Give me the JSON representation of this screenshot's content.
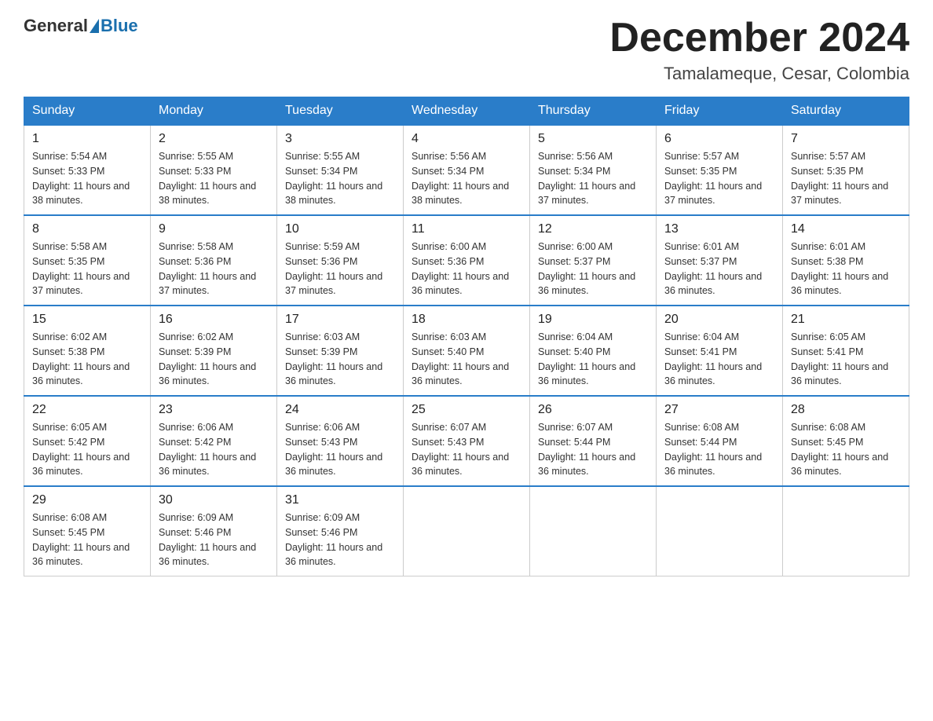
{
  "header": {
    "logo_general": "General",
    "logo_blue": "Blue",
    "month_title": "December 2024",
    "location": "Tamalameque, Cesar, Colombia"
  },
  "weekdays": [
    "Sunday",
    "Monday",
    "Tuesday",
    "Wednesday",
    "Thursday",
    "Friday",
    "Saturday"
  ],
  "weeks": [
    [
      {
        "day": "1",
        "sunrise": "5:54 AM",
        "sunset": "5:33 PM",
        "daylight": "11 hours and 38 minutes."
      },
      {
        "day": "2",
        "sunrise": "5:55 AM",
        "sunset": "5:33 PM",
        "daylight": "11 hours and 38 minutes."
      },
      {
        "day": "3",
        "sunrise": "5:55 AM",
        "sunset": "5:34 PM",
        "daylight": "11 hours and 38 minutes."
      },
      {
        "day": "4",
        "sunrise": "5:56 AM",
        "sunset": "5:34 PM",
        "daylight": "11 hours and 38 minutes."
      },
      {
        "day": "5",
        "sunrise": "5:56 AM",
        "sunset": "5:34 PM",
        "daylight": "11 hours and 37 minutes."
      },
      {
        "day": "6",
        "sunrise": "5:57 AM",
        "sunset": "5:35 PM",
        "daylight": "11 hours and 37 minutes."
      },
      {
        "day": "7",
        "sunrise": "5:57 AM",
        "sunset": "5:35 PM",
        "daylight": "11 hours and 37 minutes."
      }
    ],
    [
      {
        "day": "8",
        "sunrise": "5:58 AM",
        "sunset": "5:35 PM",
        "daylight": "11 hours and 37 minutes."
      },
      {
        "day": "9",
        "sunrise": "5:58 AM",
        "sunset": "5:36 PM",
        "daylight": "11 hours and 37 minutes."
      },
      {
        "day": "10",
        "sunrise": "5:59 AM",
        "sunset": "5:36 PM",
        "daylight": "11 hours and 37 minutes."
      },
      {
        "day": "11",
        "sunrise": "6:00 AM",
        "sunset": "5:36 PM",
        "daylight": "11 hours and 36 minutes."
      },
      {
        "day": "12",
        "sunrise": "6:00 AM",
        "sunset": "5:37 PM",
        "daylight": "11 hours and 36 minutes."
      },
      {
        "day": "13",
        "sunrise": "6:01 AM",
        "sunset": "5:37 PM",
        "daylight": "11 hours and 36 minutes."
      },
      {
        "day": "14",
        "sunrise": "6:01 AM",
        "sunset": "5:38 PM",
        "daylight": "11 hours and 36 minutes."
      }
    ],
    [
      {
        "day": "15",
        "sunrise": "6:02 AM",
        "sunset": "5:38 PM",
        "daylight": "11 hours and 36 minutes."
      },
      {
        "day": "16",
        "sunrise": "6:02 AM",
        "sunset": "5:39 PM",
        "daylight": "11 hours and 36 minutes."
      },
      {
        "day": "17",
        "sunrise": "6:03 AM",
        "sunset": "5:39 PM",
        "daylight": "11 hours and 36 minutes."
      },
      {
        "day": "18",
        "sunrise": "6:03 AM",
        "sunset": "5:40 PM",
        "daylight": "11 hours and 36 minutes."
      },
      {
        "day": "19",
        "sunrise": "6:04 AM",
        "sunset": "5:40 PM",
        "daylight": "11 hours and 36 minutes."
      },
      {
        "day": "20",
        "sunrise": "6:04 AM",
        "sunset": "5:41 PM",
        "daylight": "11 hours and 36 minutes."
      },
      {
        "day": "21",
        "sunrise": "6:05 AM",
        "sunset": "5:41 PM",
        "daylight": "11 hours and 36 minutes."
      }
    ],
    [
      {
        "day": "22",
        "sunrise": "6:05 AM",
        "sunset": "5:42 PM",
        "daylight": "11 hours and 36 minutes."
      },
      {
        "day": "23",
        "sunrise": "6:06 AM",
        "sunset": "5:42 PM",
        "daylight": "11 hours and 36 minutes."
      },
      {
        "day": "24",
        "sunrise": "6:06 AM",
        "sunset": "5:43 PM",
        "daylight": "11 hours and 36 minutes."
      },
      {
        "day": "25",
        "sunrise": "6:07 AM",
        "sunset": "5:43 PM",
        "daylight": "11 hours and 36 minutes."
      },
      {
        "day": "26",
        "sunrise": "6:07 AM",
        "sunset": "5:44 PM",
        "daylight": "11 hours and 36 minutes."
      },
      {
        "day": "27",
        "sunrise": "6:08 AM",
        "sunset": "5:44 PM",
        "daylight": "11 hours and 36 minutes."
      },
      {
        "day": "28",
        "sunrise": "6:08 AM",
        "sunset": "5:45 PM",
        "daylight": "11 hours and 36 minutes."
      }
    ],
    [
      {
        "day": "29",
        "sunrise": "6:08 AM",
        "sunset": "5:45 PM",
        "daylight": "11 hours and 36 minutes."
      },
      {
        "day": "30",
        "sunrise": "6:09 AM",
        "sunset": "5:46 PM",
        "daylight": "11 hours and 36 minutes."
      },
      {
        "day": "31",
        "sunrise": "6:09 AM",
        "sunset": "5:46 PM",
        "daylight": "11 hours and 36 minutes."
      },
      null,
      null,
      null,
      null
    ]
  ],
  "labels": {
    "sunrise": "Sunrise:",
    "sunset": "Sunset:",
    "daylight": "Daylight:"
  }
}
